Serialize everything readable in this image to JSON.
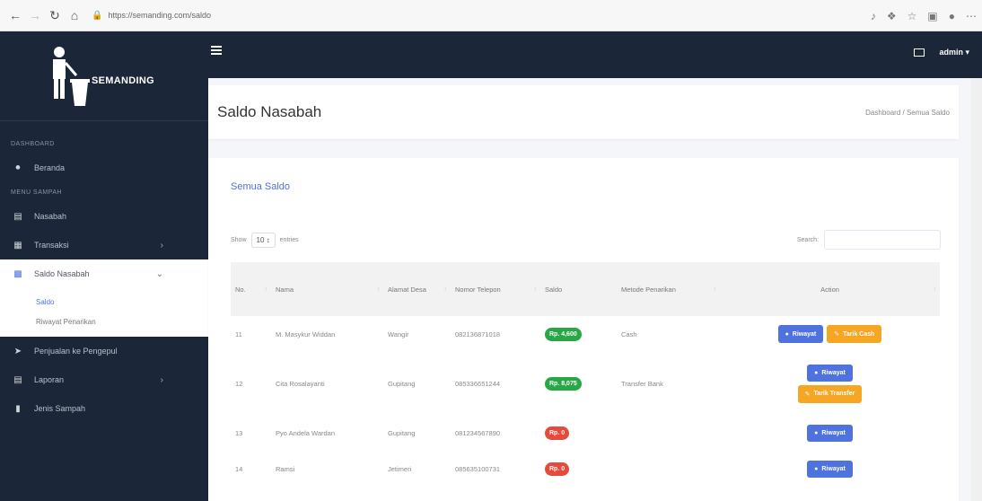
{
  "browser": {
    "url": "https://semanding.com/saldo",
    "icons": [
      "back-icon",
      "forward-icon",
      "reload-icon",
      "home-icon"
    ]
  },
  "brand": {
    "name": "SEMANDING"
  },
  "sidebar": {
    "sections": [
      {
        "header": "DASHBOARD",
        "items": [
          {
            "label": "Beranda",
            "icon": "home-icon"
          }
        ]
      },
      {
        "header": "MENU SAMPAH",
        "items": [
          {
            "label": "Nasabah",
            "icon": "users-icon"
          },
          {
            "label": "Transaksi",
            "icon": "transaction-icon",
            "has_caret": true
          },
          {
            "label": "Saldo Nasabah",
            "icon": "wallet-icon",
            "has_caret": true,
            "open": true,
            "submenu": [
              {
                "label": "Saldo",
                "active": true
              },
              {
                "label": "Riwayat Penarikan",
                "active": false
              }
            ]
          },
          {
            "label": "Penjualan ke Pengepul",
            "icon": "truck-icon"
          },
          {
            "label": "Laporan",
            "icon": "report-icon",
            "has_caret": true
          },
          {
            "label": "Jenis Sampah",
            "icon": "trash-icon"
          }
        ]
      }
    ]
  },
  "topbar": {
    "user": "admin"
  },
  "page": {
    "title": "Saldo Nasabah",
    "breadcrumb": "Dashboard / Semua Saldo"
  },
  "card": {
    "title": "Semua Saldo",
    "show_label": "Show",
    "entries_value": "10",
    "entries_label": "entries",
    "search_label": "Search:"
  },
  "table": {
    "headers": [
      "No.",
      "Nama",
      "Alamat Desa",
      "Nomor Telepon",
      "Saldo",
      "Metode Penarikan",
      "Action"
    ],
    "rows": [
      {
        "no": "11",
        "nama": "M. Masykur Widdan",
        "alamat": "Wangir",
        "telepon": "082136871018",
        "saldo": "Rp. 4,600",
        "saldo_status": "positive",
        "metode": "Cash",
        "actions": [
          {
            "label": "Riwayat",
            "kind": "blue"
          },
          {
            "label": "Tarik Cash",
            "kind": "orange"
          }
        ],
        "stacked": false
      },
      {
        "no": "12",
        "nama": "Cita Rosalayanti",
        "alamat": "Gupitang",
        "telepon": "085336651244",
        "saldo": "Rp. 8,075",
        "saldo_status": "positive",
        "metode": "Transfer Bank",
        "actions": [
          {
            "label": "Riwayat",
            "kind": "blue"
          },
          {
            "label": "Tarik Transfer",
            "kind": "orange"
          }
        ],
        "stacked": true
      },
      {
        "no": "13",
        "nama": "Pyo Andela Wardan",
        "alamat": "Gupitang",
        "telepon": "081234567890",
        "saldo": "Rp. 0",
        "saldo_status": "zero",
        "metode": "",
        "actions": [
          {
            "label": "Riwayat",
            "kind": "blue"
          }
        ],
        "stacked": false
      },
      {
        "no": "14",
        "nama": "Ramsi",
        "alamat": "Jetimeri",
        "telepon": "085635100731",
        "saldo": "Rp. 0",
        "saldo_status": "zero",
        "metode": "",
        "actions": [
          {
            "label": "Riwayat",
            "kind": "blue"
          }
        ],
        "stacked": false
      }
    ]
  },
  "colors": {
    "sidebar": "#1b2638",
    "accent": "#4e73df",
    "success": "#28a745",
    "danger": "#e74a3b",
    "warning": "#f6a623"
  }
}
